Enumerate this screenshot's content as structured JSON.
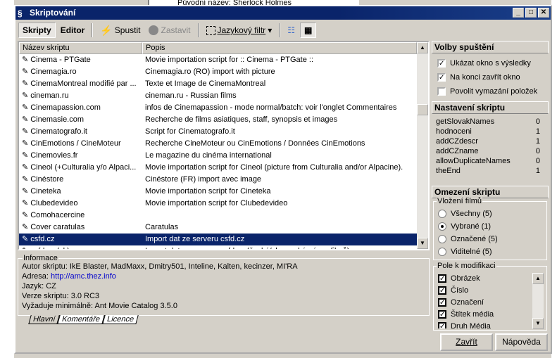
{
  "background": {
    "top_label": "Původní název:",
    "top_value": "Sherlock Holmes"
  },
  "window": {
    "title": "Skriptování"
  },
  "toolbar": {
    "scripts": "Skripty",
    "editor": "Editor",
    "run": "Spustit",
    "stop": "Zastavit",
    "lang_filter": "Jazykový filtr"
  },
  "list": {
    "columns": [
      "Název skriptu",
      "Popis"
    ],
    "rows": [
      {
        "name": "Cinema - PTGate",
        "desc": "Movie importation script for :: Cinema - PTGate ::"
      },
      {
        "name": "Cinemagia.ro",
        "desc": "Cinemagia.ro (RO) import with picture"
      },
      {
        "name": "CinemaMontreal modifié par ...",
        "desc": "Texte et Image de CinemaMontreal"
      },
      {
        "name": "cineman.ru",
        "desc": "cineman.ru - Russian films"
      },
      {
        "name": "Cinemapassion.com",
        "desc": "infos de Cinemapassion - mode normal/batch: voir l'onglet Commentaires"
      },
      {
        "name": "Cinemasie.com",
        "desc": "Recherche de films asiatiques, staff, synopsis et images"
      },
      {
        "name": "Cinematografo.it",
        "desc": "Script for Cinematografo.it"
      },
      {
        "name": "CinEmotions / CineMoteur",
        "desc": "Recherche CineMoteur ou CinEmotions / Données CinEmotions"
      },
      {
        "name": "Cinemovies.fr",
        "desc": "Le magazine du cinéma international"
      },
      {
        "name": "Cineol (+Culturalia y/o Alpaci...",
        "desc": "Movie importation script for Cineol (picture from Culturalia and/or Alpacine)."
      },
      {
        "name": "Cinéstore",
        "desc": "Cinéstore (FR) import avec image"
      },
      {
        "name": "Cineteka",
        "desc": "Movie importation script for Cineteka"
      },
      {
        "name": "Clubedevideo",
        "desc": "Movie importation script for Clubedevideo"
      },
      {
        "name": "Comohacercine",
        "desc": ""
      },
      {
        "name": "Cover caratulas",
        "desc": "Caratulas"
      },
      {
        "name": "csfd.cz",
        "desc": "Import dat ze serveru csfd.cz",
        "selected": true
      },
      {
        "name": "csfd.cz (sk)",
        "desc": "Import dat ze serveru csfd.cz (české/slovenské názvy filmů)"
      }
    ]
  },
  "info": {
    "legend": "Informace",
    "author": "Autor skriptu: IkE Blaster, MadMaxx, Dmitry501, Inteline, Kalten, kecinzer, MI'RA",
    "address_label": "Adresa: ",
    "address": "http://amc.thez.info",
    "language": "Jazyk: CZ",
    "version": "Verze skriptu: 3.0 RC3",
    "requires": "Vyžaduje minimálně: Ant Movie Catalog 3.5.0"
  },
  "tabs": [
    "Hlavní",
    "Komentáře",
    "Licence"
  ],
  "run_options": {
    "title": "Volby spuštění",
    "items": [
      {
        "label": "Ukázat okno s výsledky",
        "checked": true
      },
      {
        "label": "Na konci zavřít okno",
        "checked": true
      },
      {
        "label": "Povolit vymazání položek",
        "checked": false
      }
    ]
  },
  "script_settings": {
    "title": "Nastavení skriptu",
    "items": [
      {
        "k": "getSlovakNames",
        "v": "0"
      },
      {
        "k": "hodnoceni",
        "v": "1"
      },
      {
        "k": "addCZdescr",
        "v": "1"
      },
      {
        "k": "addCZname",
        "v": "0"
      },
      {
        "k": "allowDuplicateNames",
        "v": "0"
      },
      {
        "k": "theEnd",
        "v": "1"
      }
    ]
  },
  "limits": {
    "title": "Omezení skriptu",
    "insert_legend": "Vložení filmů",
    "radios": [
      {
        "label": "Všechny (5)",
        "on": false
      },
      {
        "label": "Vybrané (1)",
        "on": true
      },
      {
        "label": "Označené (5)",
        "on": false
      },
      {
        "label": "Viditelné (5)",
        "on": false
      }
    ],
    "fields_legend": "Pole k modifikaci",
    "fields": [
      "Obrázek",
      "Číslo",
      "Označení",
      "Štítek média",
      "Druh Média"
    ]
  },
  "buttons": {
    "close": "Zavřít",
    "help": "Nápověda"
  }
}
